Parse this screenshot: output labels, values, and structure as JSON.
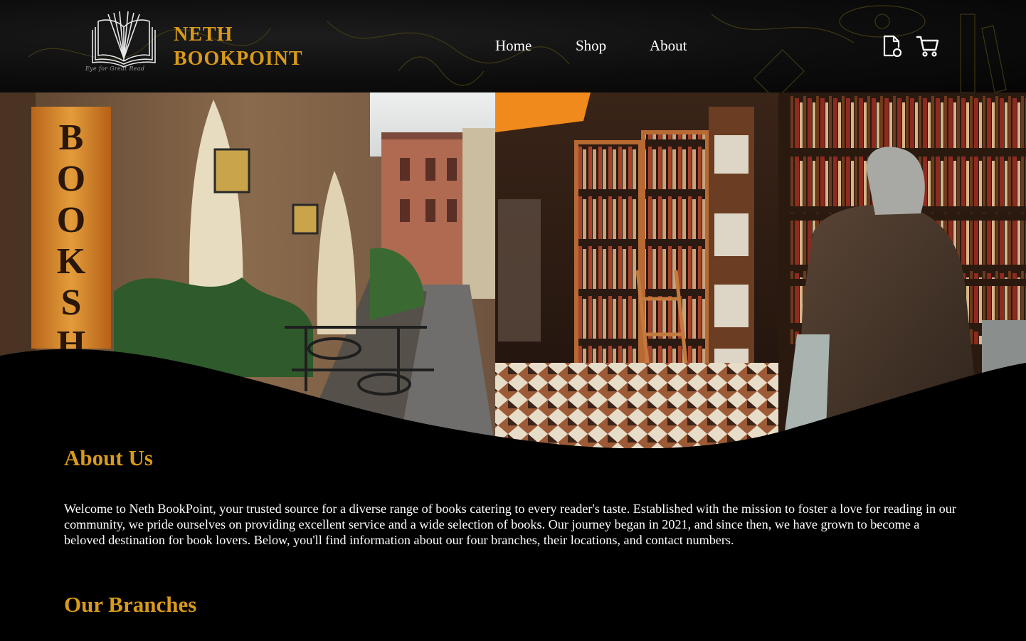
{
  "header": {
    "brand_line1": "NETH",
    "brand_line2": "BOOKPOINT",
    "tagline": "Eye for Great Read",
    "nav": {
      "home": "Home",
      "shop": "Shop",
      "about": "About"
    },
    "icons": [
      "document-icon",
      "cart-icon"
    ]
  },
  "hero": {
    "sign_text": "BOOKSH"
  },
  "about": {
    "title": "About Us",
    "body": "Welcome to Neth BookPoint, your trusted source for a diverse range of books catering to every reader's taste. Established with the mission to foster a love for reading in our community, we pride ourselves on providing excellent service and a wide selection of books. Our journey began in 2021, and since then, we have grown to become a beloved destination for book lovers. Below, you'll find information about our four branches, their locations, and contact numbers."
  },
  "branches": {
    "title": "Our Branches"
  },
  "colors": {
    "accent": "#d99a1a",
    "background": "#000000",
    "text": "#ffffff"
  }
}
